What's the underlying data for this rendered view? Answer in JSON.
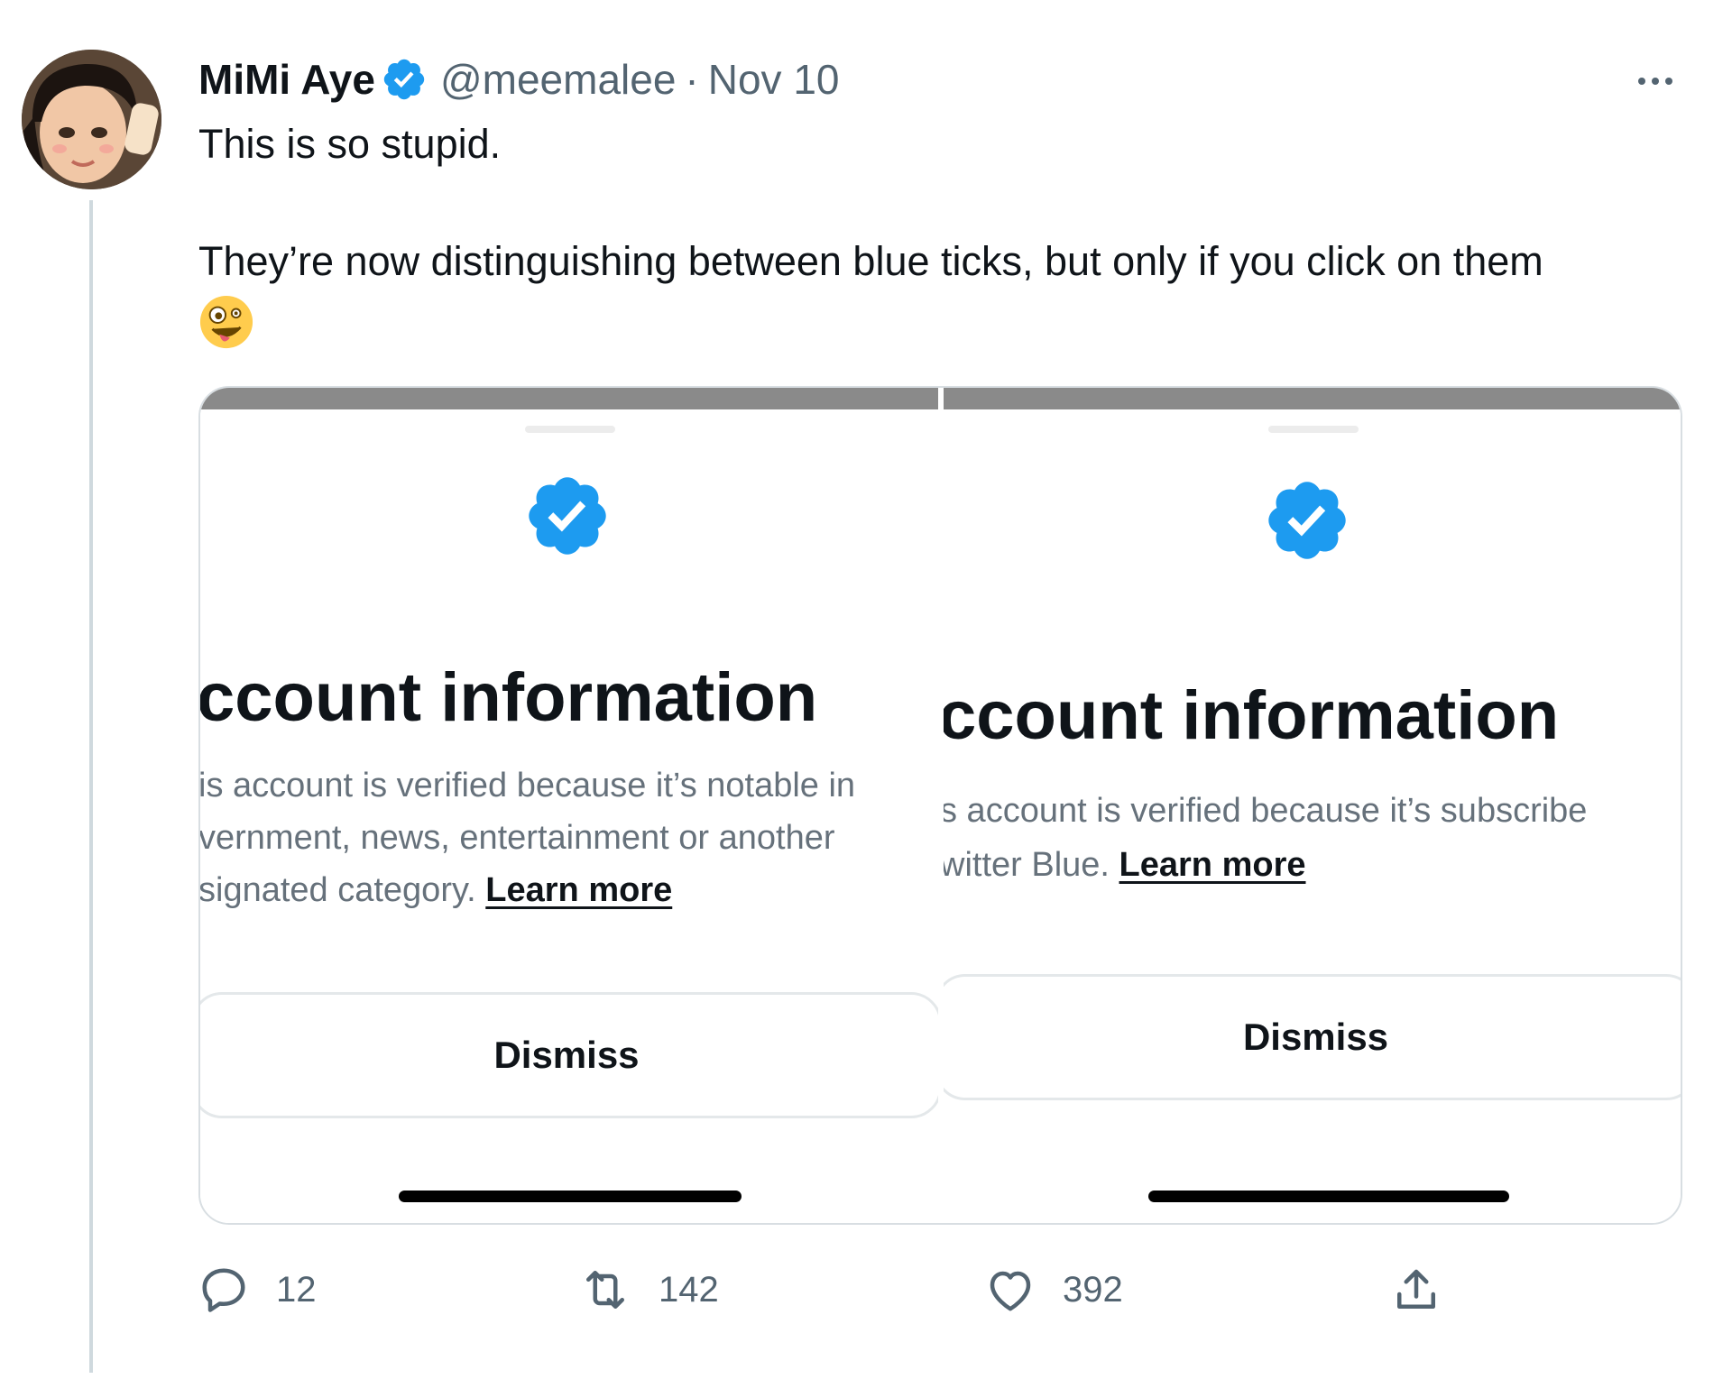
{
  "tweet": {
    "author_name": "MiMi Aye",
    "author_handle": "@meemalee",
    "separator": "·",
    "date": "Nov 10",
    "text_line1": "This is so stupid.",
    "text_line2": "They’re now distinguishing between blue ticks, but only if you click on them",
    "emoji": "zany-face-emoji",
    "accent_color": "#1d9bf0"
  },
  "media": {
    "left_panel": {
      "title": "ccount information",
      "desc_line1": "is account is verified because it’s notable in",
      "desc_line2": "vernment, news, entertainment or another",
      "desc_line3": "signated category.",
      "learn_more": "Learn more",
      "dismiss": "Dismiss"
    },
    "right_panel": {
      "title": "ccount information",
      "desc_line1": "s account is verified because it’s subscribe",
      "desc_line2": "witter Blue.",
      "learn_more": "Learn more",
      "dismiss": "Dismiss"
    }
  },
  "actions": {
    "replies": "12",
    "retweets": "142",
    "likes": "392"
  },
  "icons": [
    "verified-badge-icon",
    "more-options-icon",
    "reply-icon",
    "retweet-icon",
    "like-icon",
    "share-icon"
  ]
}
